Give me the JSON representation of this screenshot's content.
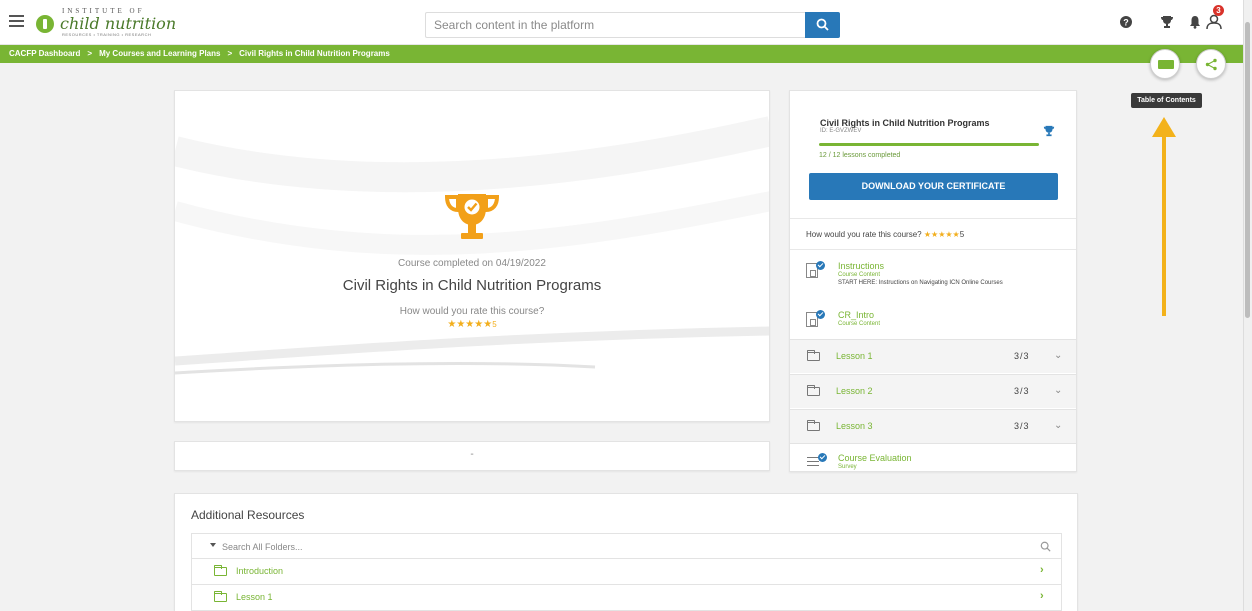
{
  "header": {
    "logo": {
      "line1": "INSTITUTE OF",
      "line2": "child nutrition",
      "line3": "RESOURCES • TRAINING • RESEARCH"
    },
    "search_placeholder": "Search content in the platform",
    "notification_count": "3",
    "brand_color": "#79b534",
    "accent_color": "#2878b8",
    "icons": [
      "menu-icon",
      "search-icon",
      "help-icon",
      "trophy-icon",
      "bell-icon",
      "profile-icon"
    ]
  },
  "breadcrumb": {
    "items": [
      "CACFP Dashboard",
      "My Courses and Learning Plans",
      "Civil Rights in Child Nutrition Programs"
    ],
    "separator": ">"
  },
  "floating": {
    "tooltip": "Table of Contents"
  },
  "hero": {
    "completed_text": "Course completed on 04/19/2022",
    "course_title": "Civil Rights in Child Nutrition Programs",
    "rate_label": "How would you rate this course?",
    "stars": "★★★★★",
    "rating": "5"
  },
  "secondary_card": {
    "text": "-"
  },
  "sidebar": {
    "course_title": "Civil Rights in Child Nutrition Programs",
    "course_id": "ID: E-GVZWEV",
    "lessons_completed": "12 / 12 lessons completed",
    "progress": 1.0,
    "certificate_button": "DOWNLOAD YOUR CERTIFICATE",
    "rate_label": "How would you rate this course?",
    "stars": "★★★★★",
    "rating": "5",
    "content_items": [
      {
        "title": "Instructions",
        "subtitle": "Course Content",
        "description": "START HERE: Instructions on Navigating ICN Online Courses"
      },
      {
        "title": "CR_Intro",
        "subtitle": "Course Content",
        "description": ""
      }
    ],
    "lessons": [
      {
        "name": "Lesson 1",
        "count": "3/3"
      },
      {
        "name": "Lesson 2",
        "count": "3/3"
      },
      {
        "name": "Lesson 3",
        "count": "3/3"
      }
    ],
    "evaluation": {
      "title": "Course Evaluation",
      "subtitle": "Survey"
    }
  },
  "resources": {
    "title": "Additional Resources",
    "search_placeholder": "Search All Folders...",
    "folders": [
      "Introduction",
      "Lesson 1"
    ]
  }
}
